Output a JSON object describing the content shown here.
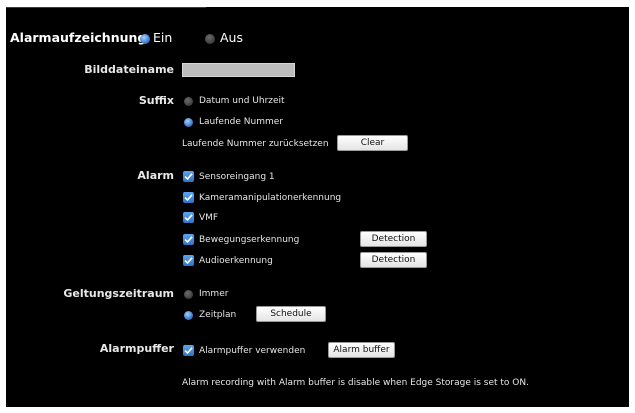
{
  "title": {
    "label": "Alarmaufzeichnung",
    "on_label": "Ein",
    "off_label": "Aus"
  },
  "filename": {
    "label": "Bilddateiname",
    "value": ""
  },
  "suffix": {
    "label": "Suffix",
    "option_datetime": "Datum und Uhrzeit",
    "option_serial": "Laufende Nummer",
    "reset_label": "Laufende Nummer zurücksetzen",
    "clear_button": "Clear"
  },
  "alarm": {
    "label": "Alarm",
    "items": [
      {
        "label": "Sensoreingang 1",
        "checked": true
      },
      {
        "label": "Kameramanipulationerkennung",
        "checked": true
      },
      {
        "label": "VMF",
        "checked": true
      },
      {
        "label": "Bewegungserkennung",
        "checked": true,
        "button": "Detection"
      },
      {
        "label": "Audioerkennung",
        "checked": true,
        "button": "Detection"
      }
    ]
  },
  "period": {
    "label": "Geltungszeitraum",
    "option_always": "Immer",
    "option_schedule": "Zeitplan",
    "schedule_button": "Schedule"
  },
  "buffer": {
    "label": "Alarmpuffer",
    "checkbox_label": "Alarmpuffer verwenden",
    "button": "Alarm buffer",
    "note": "Alarm recording with Alarm buffer is disable when Edge Storage is set to ON."
  },
  "colors": {
    "background": "#000000",
    "accent": "#3d7fd2",
    "text": "#e6e6e6"
  }
}
